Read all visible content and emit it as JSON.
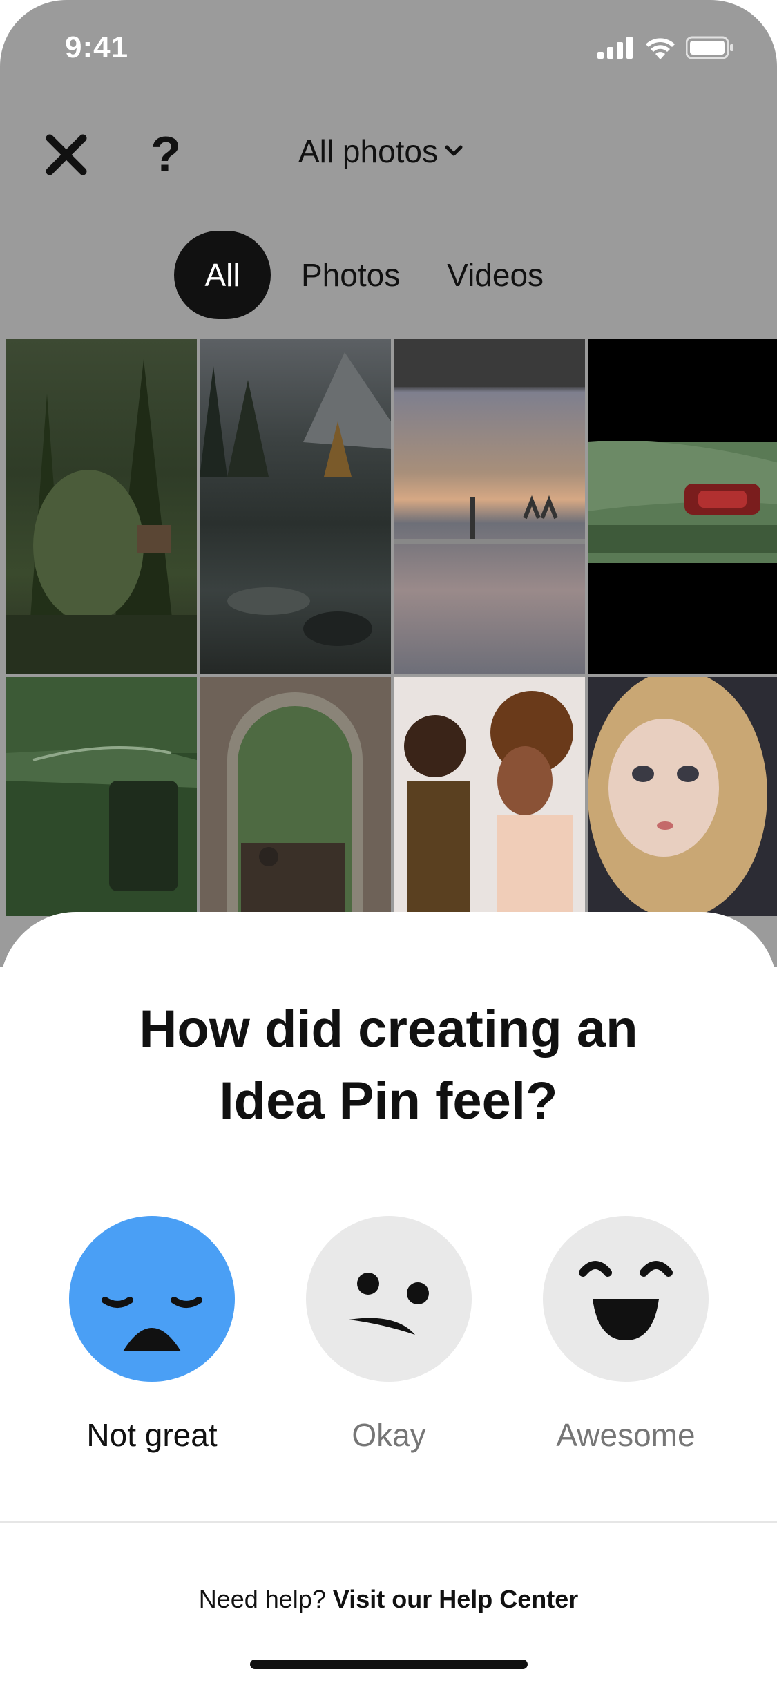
{
  "status_bar": {
    "time": "9:41"
  },
  "topbar": {
    "help_label": "?",
    "album_label": "All photos"
  },
  "filters": [
    {
      "label": "All",
      "active": true
    },
    {
      "label": "Photos",
      "active": false
    },
    {
      "label": "Videos",
      "active": false
    }
  ],
  "sheet": {
    "title_line1": "How did creating an",
    "title_line2": "Idea Pin feel?",
    "reactions": [
      {
        "label": "Not great",
        "icon": "sad-face-icon",
        "selected": true
      },
      {
        "label": "Okay",
        "icon": "meh-face-icon",
        "selected": false
      },
      {
        "label": "Awesome",
        "icon": "happy-face-icon",
        "selected": false
      }
    ],
    "help_prefix": "Need help?",
    "help_link": "Visit our Help Center"
  },
  "colors": {
    "selected_reaction": "#4a9ff5",
    "neutral_reaction": "#e9e9e9",
    "overlay": "#9b9b9b",
    "dark": "#111111"
  }
}
